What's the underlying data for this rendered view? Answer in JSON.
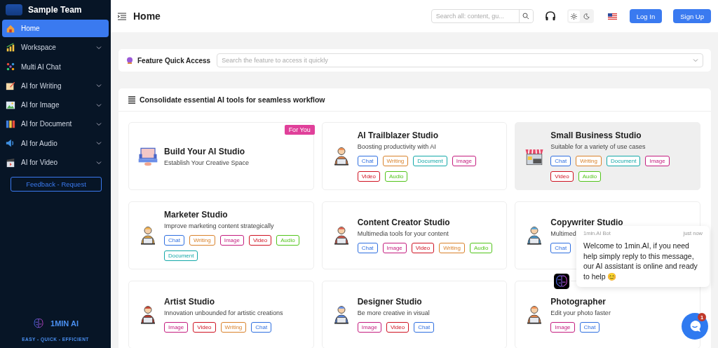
{
  "sidebar": {
    "team_name": "Sample Team",
    "items": [
      {
        "label": "Home",
        "selected": true,
        "expandable": false
      },
      {
        "label": "Workspace",
        "selected": false,
        "expandable": true
      },
      {
        "label": "Multi AI Chat",
        "selected": false,
        "expandable": false
      },
      {
        "label": "AI for Writing",
        "selected": false,
        "expandable": true
      },
      {
        "label": "AI for Image",
        "selected": false,
        "expandable": true
      },
      {
        "label": "AI for Document",
        "selected": false,
        "expandable": true
      },
      {
        "label": "AI for Audio",
        "selected": false,
        "expandable": true
      },
      {
        "label": "AI for Video",
        "selected": false,
        "expandable": true
      }
    ],
    "feedback_button": "Feedback - Request",
    "brand": {
      "name": "1MIN AI",
      "tagline": "EASY - QUICK - EFFICIENT"
    }
  },
  "header": {
    "title": "Home",
    "search": {
      "placeholder": "Search all: content, gu..."
    },
    "theme_options": [
      {
        "kind": "light",
        "selected": true
      },
      {
        "kind": "dark",
        "selected": false
      }
    ],
    "buttons": [
      "Log In",
      "Sign Up"
    ]
  },
  "quick_access": {
    "label": "Feature Quick Access",
    "placeholder": "Search the feature to access it quickly"
  },
  "tools": {
    "title": "Consolidate essential AI tools for seamless workflow",
    "studios": [
      {
        "name": "Build Your AI Studio",
        "description": "Establish Your Creative Space",
        "badge": "For You",
        "selected": false
      },
      {
        "name": "AI Trailblazer Studio",
        "description": "Boosting productivity with AI",
        "selected": false,
        "tags": [
          {
            "label": "Chat",
            "color": "#2f6fe0"
          },
          {
            "label": "Writing",
            "color": "#d9822b"
          },
          {
            "label": "Document",
            "color": "#13a8a8"
          },
          {
            "label": "Image",
            "color": "#c41d7f"
          },
          {
            "label": "Video",
            "color": "#cf1322"
          },
          {
            "label": "Audio",
            "color": "#52c41a"
          }
        ]
      },
      {
        "name": "Small Business Studio",
        "description": "Suitable for a variety of use cases",
        "selected": true,
        "tags": [
          {
            "label": "Chat",
            "color": "#2f6fe0"
          },
          {
            "label": "Writing",
            "color": "#d9822b"
          },
          {
            "label": "Document",
            "color": "#13a8a8"
          },
          {
            "label": "Image",
            "color": "#c41d7f"
          },
          {
            "label": "Video",
            "color": "#cf1322"
          },
          {
            "label": "Audio",
            "color": "#52c41a"
          }
        ]
      },
      {
        "name": "Marketer Studio",
        "description": "Improve marketing content strategically",
        "selected": false,
        "tags": [
          {
            "label": "Chat",
            "color": "#2f6fe0"
          },
          {
            "label": "Writing",
            "color": "#d9822b"
          },
          {
            "label": "Image",
            "color": "#c41d7f"
          },
          {
            "label": "Video",
            "color": "#cf1322"
          },
          {
            "label": "Audio",
            "color": "#52c41a"
          },
          {
            "label": "Document",
            "color": "#13a8a8"
          }
        ]
      },
      {
        "name": "Content Creator Studio",
        "description": "Multimedia tools for your content",
        "selected": false,
        "tags": [
          {
            "label": "Chat",
            "color": "#2f6fe0"
          },
          {
            "label": "Image",
            "color": "#c41d7f"
          },
          {
            "label": "Video",
            "color": "#cf1322"
          },
          {
            "label": "Writing",
            "color": "#d9822b"
          },
          {
            "label": "Audio",
            "color": "#52c41a"
          }
        ]
      },
      {
        "name": "Copywriter Studio",
        "description": "Multimed",
        "selected": false,
        "tags": [
          {
            "label": "Chat",
            "color": "#2f6fe0"
          }
        ]
      },
      {
        "name": "Artist Studio",
        "description": "Innovation unbounded for artistic creations",
        "selected": false,
        "tags": [
          {
            "label": "Image",
            "color": "#c41d7f"
          },
          {
            "label": "Video",
            "color": "#cf1322"
          },
          {
            "label": "Writing",
            "color": "#d9822b"
          },
          {
            "label": "Chat",
            "color": "#2f6fe0"
          }
        ]
      },
      {
        "name": "Designer Studio",
        "description": "Be more creative in visual",
        "selected": false,
        "tags": [
          {
            "label": "Image",
            "color": "#c41d7f"
          },
          {
            "label": "Video",
            "color": "#cf1322"
          },
          {
            "label": "Chat",
            "color": "#2f6fe0"
          }
        ]
      },
      {
        "name": "Photographer",
        "description": "Edit your photo faster",
        "selected": false,
        "tags": [
          {
            "label": "Image",
            "color": "#c41d7f"
          },
          {
            "label": "Chat",
            "color": "#2f6fe0"
          }
        ]
      }
    ]
  },
  "chat": {
    "sender": "1min.AI Bot",
    "time": "just now",
    "message": "Welcome to 1min.AI, if you need help simply reply to this message, our AI assistant is online and ready to help 😊",
    "unread": "1"
  }
}
